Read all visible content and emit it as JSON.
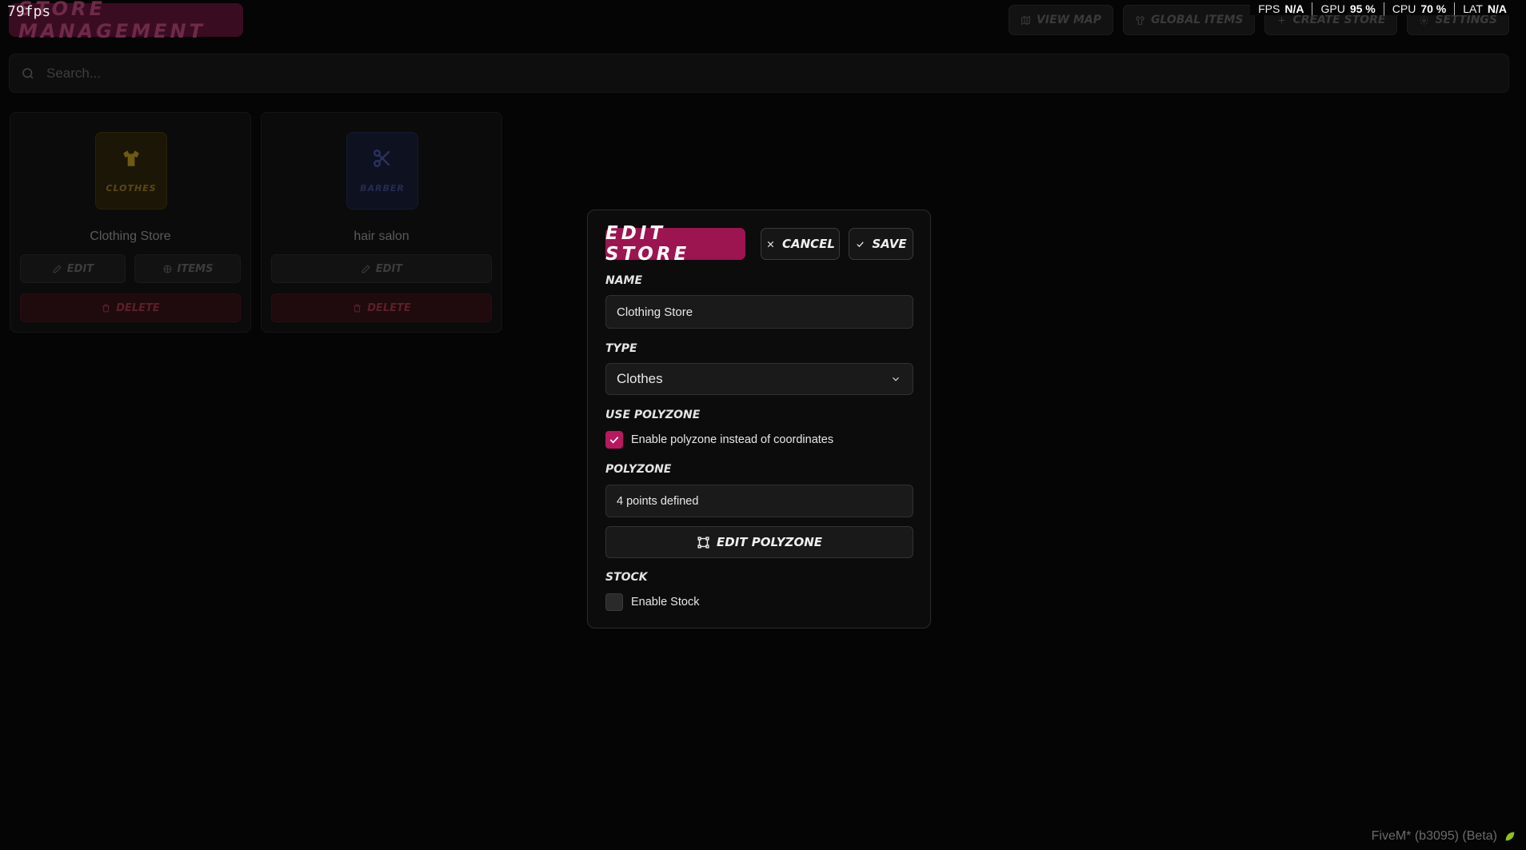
{
  "overlay": {
    "fps_counter": "79fps",
    "perf": [
      {
        "label": "FPS",
        "value": "N/A"
      },
      {
        "label": "GPU",
        "value": "95 %"
      },
      {
        "label": "CPU",
        "value": "70 %"
      },
      {
        "label": "LAT",
        "value": "N/A"
      }
    ],
    "version": "FiveM* (b3095) (Beta)"
  },
  "header": {
    "title": "STORE MANAGEMENT",
    "nav": [
      {
        "label": "View Map",
        "icon": "map-icon"
      },
      {
        "label": "Global Items",
        "icon": "shirt-icon"
      },
      {
        "label": "Create Store",
        "icon": "plus-icon"
      },
      {
        "label": "Settings",
        "icon": "gear-icon"
      }
    ]
  },
  "search": {
    "placeholder": "Search..."
  },
  "stores": [
    {
      "name": "Clothing Store",
      "type_tag": "CLOTHES",
      "icon": "shirt-icon",
      "edit_label": "Edit",
      "items_label": "Items",
      "delete_label": "Delete"
    },
    {
      "name": "hair salon",
      "type_tag": "BARBER",
      "icon": "scissors-icon",
      "edit_label": "Edit",
      "delete_label": "Delete"
    }
  ],
  "modal": {
    "title": "Edit Store",
    "cancel_label": "Cancel",
    "save_label": "Save",
    "name_label": "Name",
    "name_value": "Clothing Store",
    "type_label": "Type",
    "type_value": "Clothes",
    "use_polyzone_label": "Use Polyzone",
    "use_polyzone_checkbox_text": "Enable polyzone instead of coordinates",
    "use_polyzone_checked": true,
    "polyzone_label": "Polyzone",
    "polyzone_value": "4 points defined",
    "edit_polyzone_label": "Edit Polyzone",
    "stock_label": "Stock",
    "stock_checkbox_text": "Enable Stock",
    "stock_checked": false
  },
  "colors": {
    "accent": "#b8185f",
    "title_bg": "#9c1450",
    "clothes_tag": "#6e5a10",
    "barber_tag": "#2a3360"
  }
}
